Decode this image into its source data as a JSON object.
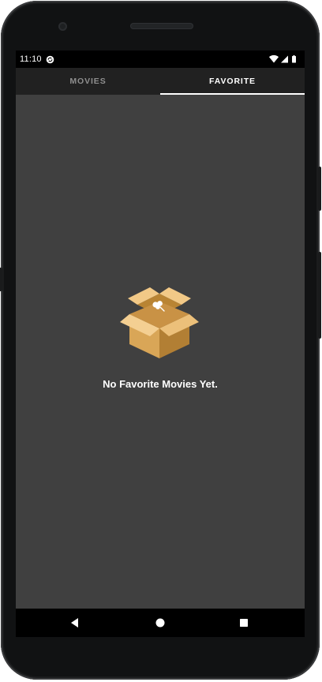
{
  "status_bar": {
    "time": "11:10",
    "icons": [
      "sync-icon",
      "wifi-icon",
      "signal-icon",
      "battery-icon"
    ]
  },
  "tabs": [
    {
      "label": "MOVIES",
      "selected": false
    },
    {
      "label": "FAVORITE",
      "selected": true
    }
  ],
  "empty_state": {
    "icon": "open-box-icon",
    "message": "No Favorite Movies Yet."
  },
  "navigation": {
    "buttons": [
      "back-icon",
      "home-icon",
      "recents-icon"
    ]
  },
  "colors": {
    "background": "#404040",
    "tab_bar": "#212121",
    "tab_active": "#ffffff",
    "tab_inactive": "#8f8f8f",
    "box": "#d9a657"
  }
}
